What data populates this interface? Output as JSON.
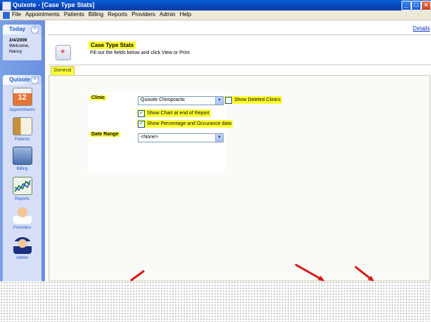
{
  "window": {
    "title": "Quixote - [Case Type Stats]"
  },
  "menu": [
    "File",
    "Appointments",
    "Patients",
    "Billing",
    "Reports",
    "Providers",
    "Admin",
    "Help"
  ],
  "today": {
    "header": "Today",
    "date": "2/4/2009",
    "welcome": "Welcome,",
    "user": "Nancy"
  },
  "nav": {
    "header": "Quixote",
    "items": [
      {
        "label": "Appointments",
        "icon": "calendar-icon"
      },
      {
        "label": "Patients",
        "icon": "patient-card-icon"
      },
      {
        "label": "Billing",
        "icon": "billing-icon"
      },
      {
        "label": "Reports",
        "icon": "chart-icon"
      },
      {
        "label": "Providers",
        "icon": "doctor-icon"
      },
      {
        "label": "Admin",
        "icon": "officer-icon"
      }
    ]
  },
  "header": {
    "details_link": "Details",
    "title": "Case Type Stats",
    "subtitle": "Fill out the fields below and click View or Print."
  },
  "tabs": [
    "General"
  ],
  "form": {
    "clinic_label": "Clinic",
    "clinic_value": "Quixote Chiropractic",
    "show_deleted_label": "Show Deleted Clinics",
    "show_deleted_checked": false,
    "show_chart_label": "Show Chart at end of Report",
    "show_chart_checked": true,
    "show_percentage_label": "Show Percentage and Occurance data",
    "show_percentage_checked": true,
    "date_range_label": "Date Range",
    "date_range_value": "<None>"
  },
  "colors": {
    "highlight": "#ffff33",
    "title_bar": "#0844b8",
    "sidebar": "#6b8fe0",
    "arrows": "#d81818"
  }
}
